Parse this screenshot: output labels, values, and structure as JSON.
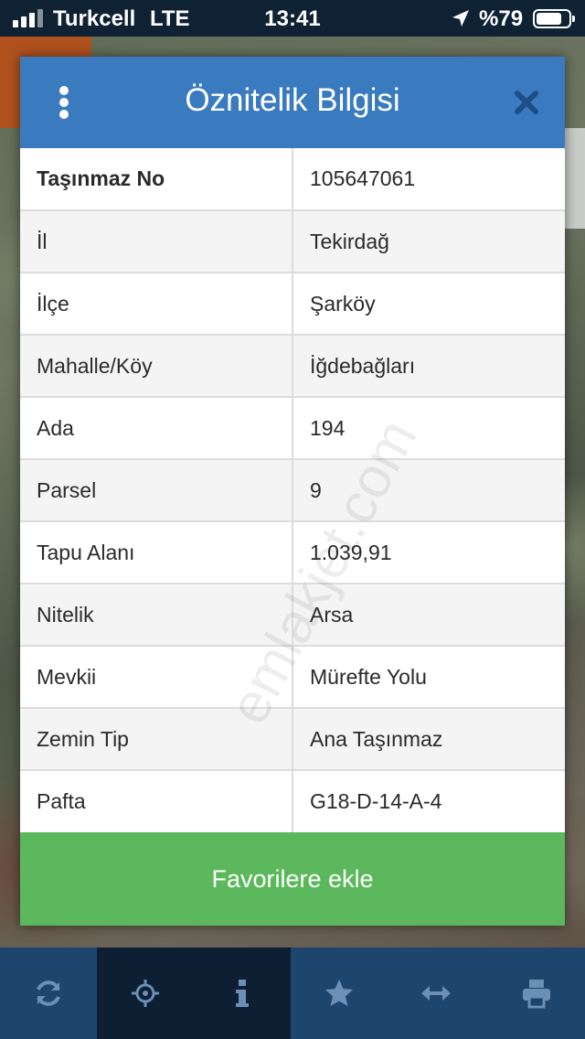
{
  "status_bar": {
    "carrier": "Turkcell",
    "network": "LTE",
    "time": "13:41",
    "battery": "%79",
    "battery_level": 0.79
  },
  "dialog": {
    "title": "Öznitelik Bilgisi",
    "menu_icon": "vertical-dots-icon",
    "close_icon": "close-icon",
    "rows": [
      {
        "key": "Taşınmaz No",
        "value": "105647061"
      },
      {
        "key": "İl",
        "value": "Tekirdağ"
      },
      {
        "key": "İlçe",
        "value": "Şarköy"
      },
      {
        "key": "Mahalle/Köy",
        "value": "İğdebağları"
      },
      {
        "key": "Ada",
        "value": "194"
      },
      {
        "key": "Parsel",
        "value": "9"
      },
      {
        "key": "Tapu Alanı",
        "value": "1.039,91"
      },
      {
        "key": "Nitelik",
        "value": "Arsa"
      },
      {
        "key": "Mevkii",
        "value": "Mürefte Yolu"
      },
      {
        "key": "Zemin Tip",
        "value": "Ana Taşınmaz"
      },
      {
        "key": "Pafta",
        "value": "G18-D-14-A-4"
      }
    ],
    "favorite_button": "Favorilere ekle"
  },
  "watermark": "emlakjet.com",
  "toolbar": {
    "items": [
      {
        "icon": "refresh-icon",
        "active": false
      },
      {
        "icon": "crosshair-icon",
        "active": true
      },
      {
        "icon": "info-icon",
        "active": true
      },
      {
        "icon": "star-icon",
        "active": false
      },
      {
        "icon": "measure-arrows-icon",
        "active": false
      },
      {
        "icon": "print-icon",
        "active": false
      }
    ]
  },
  "colors": {
    "header": "#3a7abf",
    "favorite": "#5cb85c",
    "toolbar": "#1d456e",
    "toolbar_active": "#0c1f33"
  }
}
